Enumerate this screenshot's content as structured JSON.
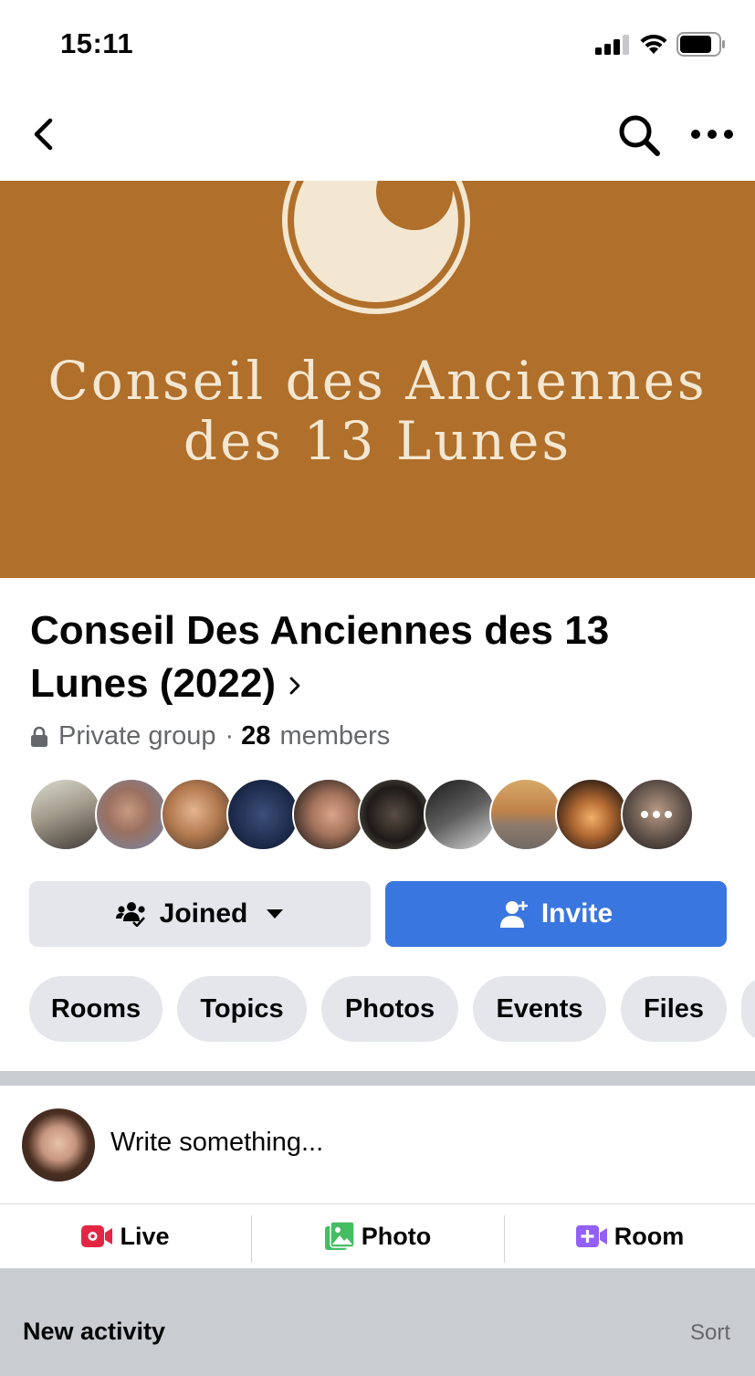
{
  "status_bar": {
    "time": "15:11",
    "signal_icon": "cellular-signal-icon",
    "wifi_icon": "wifi-icon",
    "battery_icon": "battery-icon"
  },
  "nav": {
    "back_icon": "chevron-left-icon",
    "search_icon": "search-icon",
    "more_icon": "more-horizontal-icon"
  },
  "cover": {
    "line1": "Conseil des Anciennes",
    "line2": "des 13 Lunes",
    "background_color": "#b06f2a",
    "text_color": "#f3e7d2"
  },
  "group": {
    "title": "Conseil Des Anciennes des 13 Lunes (2022)",
    "privacy": "Private group",
    "separator": "·",
    "member_count": "28",
    "member_label": "members"
  },
  "member_avatars": [
    {
      "name": "member-avatar-1"
    },
    {
      "name": "member-avatar-2"
    },
    {
      "name": "member-avatar-3"
    },
    {
      "name": "member-avatar-4"
    },
    {
      "name": "member-avatar-5"
    },
    {
      "name": "member-avatar-6"
    },
    {
      "name": "member-avatar-7"
    },
    {
      "name": "member-avatar-8"
    },
    {
      "name": "member-avatar-9"
    },
    {
      "name": "member-avatar-more"
    }
  ],
  "buttons": {
    "joined": "Joined",
    "invite": "Invite",
    "invite_color": "#3a76df"
  },
  "tabs": [
    "Rooms",
    "Topics",
    "Photos",
    "Events",
    "Files"
  ],
  "composer": {
    "placeholder": "Write something..."
  },
  "actions": {
    "live": "Live",
    "photo": "Photo",
    "room": "Room"
  },
  "feed": {
    "section_title": "New activity",
    "sort": "Sort"
  }
}
